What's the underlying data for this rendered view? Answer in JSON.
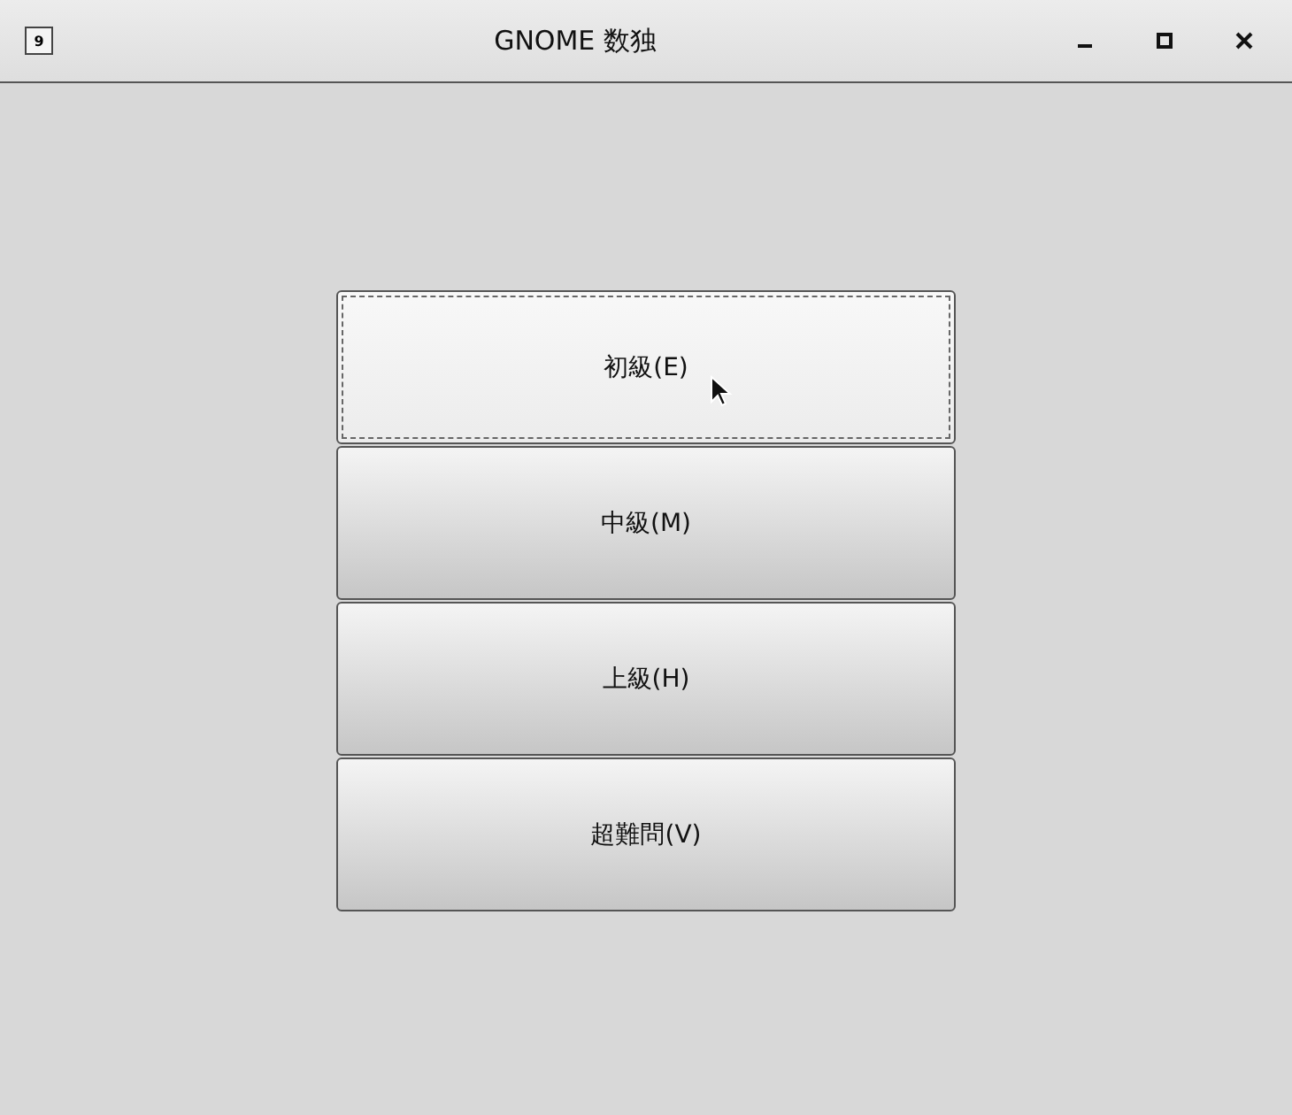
{
  "window": {
    "title": "GNOME 数独",
    "app_icon": "9"
  },
  "buttons": [
    {
      "label": "初級(E)",
      "focused": true
    },
    {
      "label": "中級(M)",
      "focused": false
    },
    {
      "label": "上級(H)",
      "focused": false
    },
    {
      "label": "超難問(V)",
      "focused": false
    }
  ]
}
